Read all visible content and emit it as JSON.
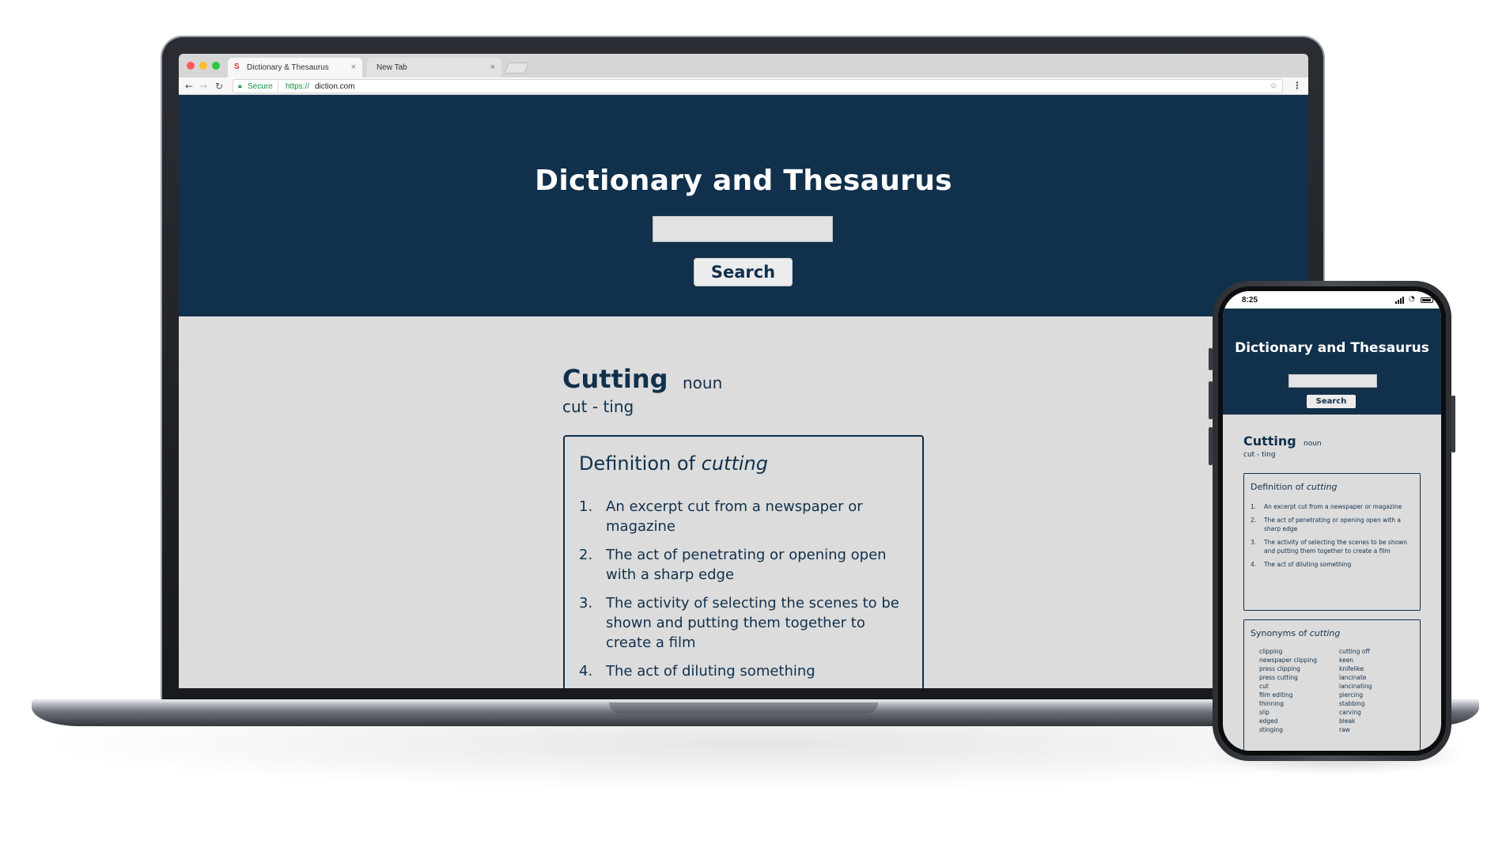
{
  "browser": {
    "tabs": [
      {
        "favicon": "S",
        "title": "Dictionary & Thesaurus",
        "close": "×"
      },
      {
        "title": "New Tab",
        "close": "×"
      }
    ],
    "secure_label": "Secure",
    "url_scheme": "https://",
    "url_host": "diction.com",
    "icons": [
      "back-arrow-icon",
      "forward-arrow-icon",
      "reload-icon",
      "lock-icon",
      "bookmark-star-icon",
      "menu-dots-icon"
    ],
    "colors": {
      "secure": "#1e8e3e",
      "close_red": "#fd5b57",
      "minimize_yellow": "#fdbd30",
      "maximize_green": "#28c840"
    }
  },
  "site": {
    "title": "Dictionary and Thesaurus",
    "search_button": "Search",
    "search_value": ""
  },
  "entry": {
    "word": "Cutting",
    "part_of_speech": "noun",
    "syllables": "cut - ting",
    "definition_heading": "Definition of",
    "definition_word": "cutting",
    "definitions": [
      {
        "num": "1.",
        "text": "An excerpt cut from a newspaper or magazine"
      },
      {
        "num": "2.",
        "text": "The act of penetrating or opening open with a sharp edge"
      },
      {
        "num": "3.",
        "text": "The activity of selecting the scenes to be shown and putting them together to create a film"
      },
      {
        "num": "4.",
        "text": "The act of diluting something"
      }
    ],
    "synonyms_heading": "Synonyms of",
    "synonyms_word": "cutting",
    "synonyms_col1": [
      "clipping",
      "newspaper clipping",
      "press clipping",
      "press cutting",
      "cut",
      "film editing",
      "thinning",
      "slip",
      "edged",
      "stinging"
    ],
    "synonyms_col2": [
      "cutting off",
      "keen",
      "knifelike",
      "lancinate",
      "lancinating",
      "piercing",
      "stabbing",
      "carving",
      "bleak",
      "raw"
    ]
  },
  "phone": {
    "status_time": "8:25"
  },
  "colors": {
    "brand_navy": "#11304c",
    "page_background": "#dcdcdc",
    "button_background": "#ececec"
  }
}
